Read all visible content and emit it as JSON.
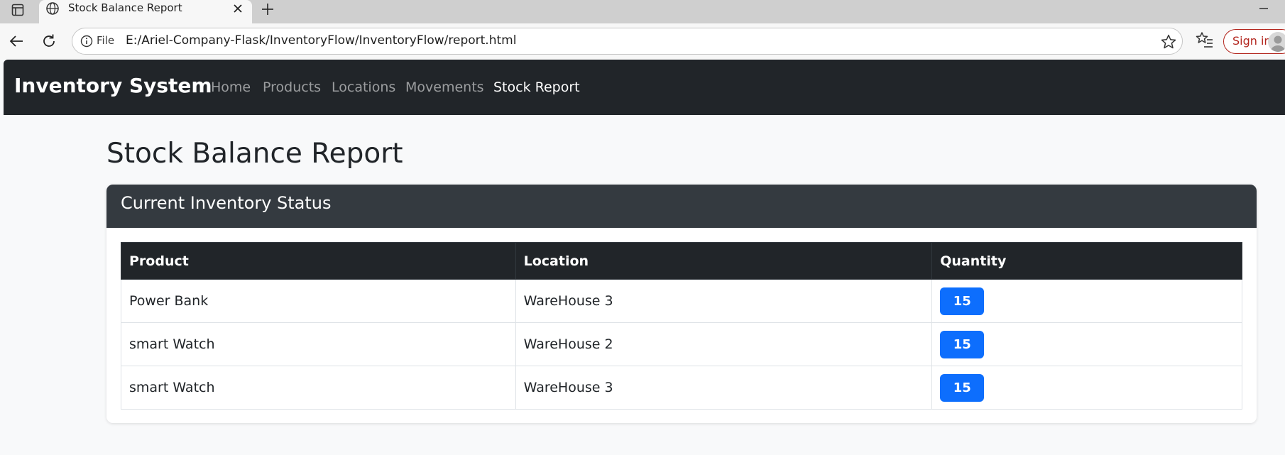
{
  "browser": {
    "tab_title": "Stock Balance Report",
    "address_label": "File",
    "url": "E:/Ariel-Company-Flask/InventoryFlow/InventoryFlow/report.html",
    "signin_label": "Sign in"
  },
  "navbar": {
    "brand": "Inventory System",
    "links": [
      {
        "label": "Home",
        "active": false
      },
      {
        "label": "Products",
        "active": false
      },
      {
        "label": "Locations",
        "active": false
      },
      {
        "label": "Movements",
        "active": false
      },
      {
        "label": "Stock Report",
        "active": true
      }
    ]
  },
  "page": {
    "title": "Stock Balance Report"
  },
  "card": {
    "title": "Current Inventory Status",
    "columns": [
      "Product",
      "Location",
      "Quantity"
    ],
    "rows": [
      {
        "product": "Power Bank",
        "location": "WareHouse 3",
        "quantity": "15"
      },
      {
        "product": "smart Watch",
        "location": "WareHouse 2",
        "quantity": "15"
      },
      {
        "product": "smart Watch",
        "location": "WareHouse 3",
        "quantity": "15"
      }
    ]
  },
  "colors": {
    "navbar_bg": "#212529",
    "card_header_bg": "#343a40",
    "badge_bg": "#0d6efd",
    "signin_accent": "#b3261e"
  },
  "icons": {
    "tab_actions": "sidebar-icon",
    "tab_favicon": "globe-icon",
    "close": "close-icon",
    "new_tab": "plus-icon",
    "back": "back-arrow-icon",
    "reload": "reload-icon",
    "site_info": "info-icon",
    "bookmark": "star-icon",
    "favorites": "favorites-icon",
    "avatar": "avatar-icon"
  }
}
